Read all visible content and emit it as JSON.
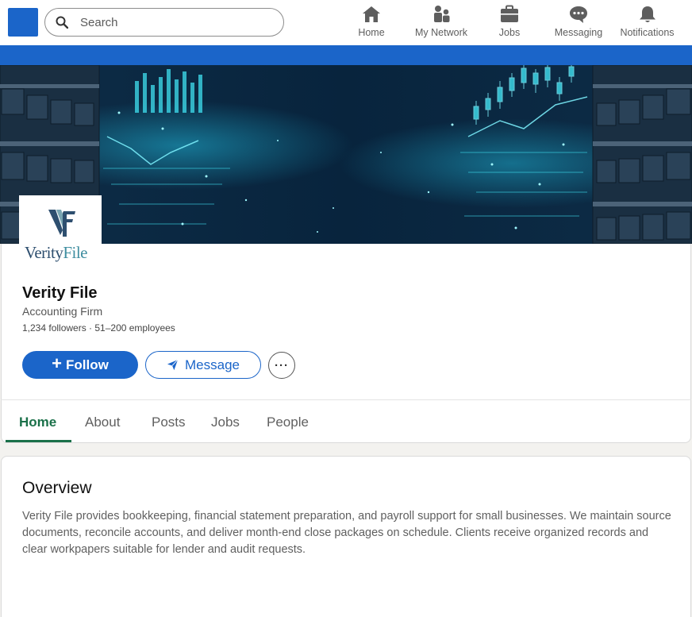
{
  "topnav": {
    "search_placeholder": "Search",
    "items": [
      {
        "label": "Home",
        "icon": "home-icon"
      },
      {
        "label": "My Network",
        "icon": "people-icon"
      },
      {
        "label": "Jobs",
        "icon": "briefcase-icon"
      },
      {
        "label": "Messaging",
        "icon": "chat-icon"
      },
      {
        "label": "Notifications",
        "icon": "bell-icon"
      }
    ]
  },
  "company": {
    "logo_wordmark_a": "Verity",
    "logo_wordmark_b": "File",
    "name": "Verity File",
    "type": "Accounting Firm",
    "meta": "1,234 followers · 51–200 employees"
  },
  "actions": {
    "follow_plus": "+",
    "follow_label": "Follow",
    "message_label": "Message",
    "more_label": "···"
  },
  "tabs": [
    {
      "label": "Home",
      "active": true
    },
    {
      "label": "About",
      "active": false
    },
    {
      "label": "Posts",
      "active": false
    },
    {
      "label": "Jobs",
      "active": false
    },
    {
      "label": "People",
      "active": false
    }
  ],
  "overview": {
    "title": "Overview",
    "text": "Verity File provides bookkeeping, financial statement preparation, and payroll support for small businesses. We maintain source documents, reconcile accounts, and deliver month-end close packages on schedule. Clients receive organized records and clear workpapers suitable for lender and audit requests."
  },
  "colors": {
    "brand_blue": "#1b65c9",
    "active_tab_green": "#1a7049",
    "banner_dark": "#0a2a45",
    "banner_glow": "#3fe0f0"
  }
}
